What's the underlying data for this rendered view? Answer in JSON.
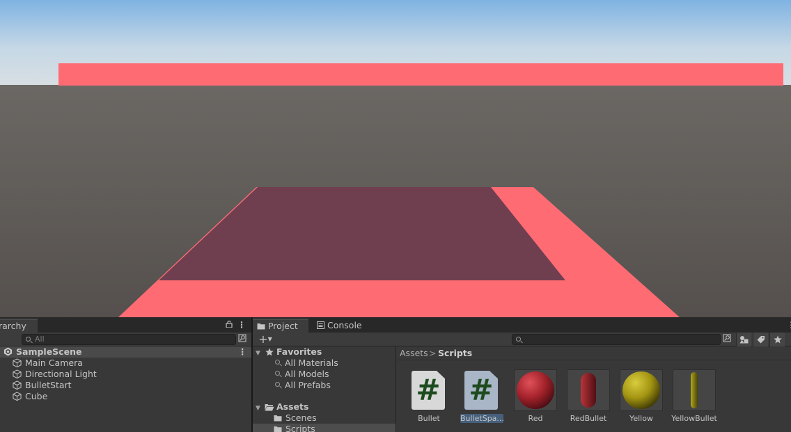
{
  "hierarchy": {
    "tab_label": "rarchy",
    "search_placeholder": "All",
    "scene_name": "SampleScene",
    "items": [
      {
        "label": "Main Camera"
      },
      {
        "label": "Directional Light"
      },
      {
        "label": "BulletStart"
      },
      {
        "label": "Cube"
      }
    ]
  },
  "project": {
    "tabs": [
      {
        "label": "Project"
      },
      {
        "label": "Console"
      }
    ],
    "add_button": "+",
    "favorites": {
      "label": "Favorites",
      "items": [
        {
          "label": "All Materials"
        },
        {
          "label": "All Models"
        },
        {
          "label": "All Prefabs"
        }
      ]
    },
    "assets": {
      "label": "Assets",
      "folders": [
        {
          "label": "Scenes"
        },
        {
          "label": "Scripts"
        }
      ]
    },
    "breadcrumb": {
      "root": "Assets",
      "separator": ">",
      "current": "Scripts"
    },
    "assets_grid": [
      {
        "label": "Bullet",
        "type": "script"
      },
      {
        "label": "BulletSpa...",
        "type": "script",
        "selected": true
      },
      {
        "label": "Red",
        "type": "material-sphere",
        "color": "#b5262c"
      },
      {
        "label": "RedBullet",
        "type": "capsule",
        "color": "#8e1f22"
      },
      {
        "label": "Yellow",
        "type": "material-sphere",
        "color": "#b9a915"
      },
      {
        "label": "YellowBullet",
        "type": "thin-capsule",
        "color": "#8c8412"
      }
    ]
  },
  "colors": {
    "scene_object": "#ff6b73",
    "scene_floor": "#6f3f50",
    "sky_top": "#85b8e6",
    "ground": "#5e5854",
    "panel": "#383838",
    "selection": "#46607c"
  }
}
